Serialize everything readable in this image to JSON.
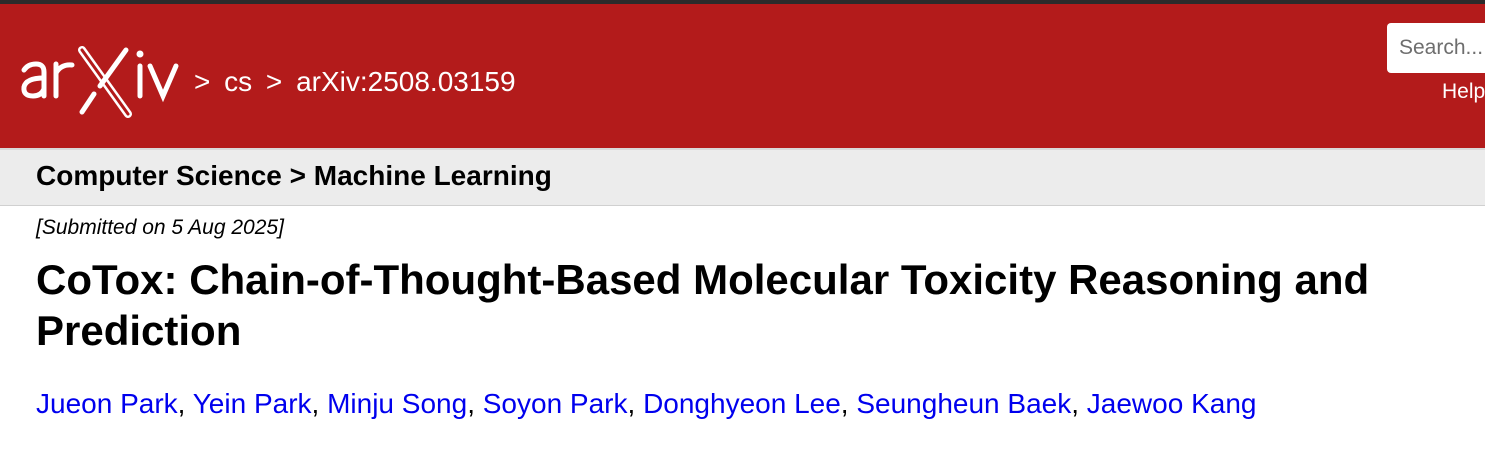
{
  "header": {
    "logo_text": "arXiv",
    "breadcrumb": {
      "separator": ">",
      "archive": "cs",
      "paper_id": "arXiv:2508.03159"
    },
    "search_placeholder": "Search...",
    "help_label": "Help",
    "brand_color": "#b31b1b"
  },
  "subheader": {
    "text": "Computer Science > Machine Learning"
  },
  "paper": {
    "submitted": "[Submitted on 5 Aug 2025]",
    "title": "CoTox: Chain-of-Thought-Based Molecular Toxicity Reasoning and Prediction",
    "authors": [
      "Jueon Park",
      "Yein Park",
      "Minju Song",
      "Soyon Park",
      "Donghyeon Lee",
      "Seungheun Baek",
      "Jaewoo Kang"
    ],
    "author_separator": ", "
  }
}
